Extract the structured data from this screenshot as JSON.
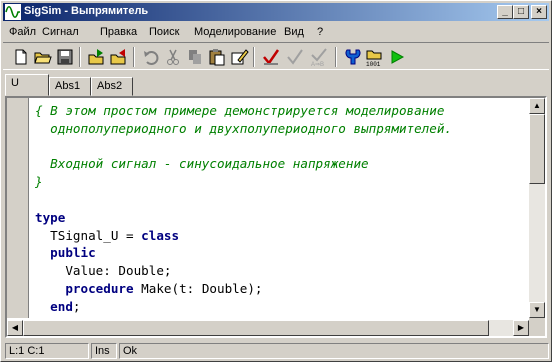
{
  "window": {
    "title": "SigSim - Выпрямитель",
    "minimize": "_",
    "maximize": "□",
    "close": "×"
  },
  "menu": [
    {
      "label": "Файл"
    },
    {
      "label": "Сигнал"
    },
    {
      "label": "Правка"
    },
    {
      "label": "Поиск"
    },
    {
      "label": "Моделирование"
    },
    {
      "label": "Вид"
    },
    {
      "label": "?"
    }
  ],
  "toolbar": {
    "icons": [
      "new-file-icon",
      "open-folder-icon",
      "save-icon",
      "import-signal-icon",
      "export-signal-icon",
      "undo-icon",
      "cut-icon",
      "copy-icon",
      "paste-icon",
      "edit-icon",
      "check-icon",
      "check-disabled-icon",
      "check-ab-icon",
      "settings-icon",
      "compile-icon",
      "run-icon"
    ]
  },
  "tabs": [
    {
      "label": "U",
      "active": true
    },
    {
      "label": "Abs1",
      "active": false
    },
    {
      "label": "Abs2",
      "active": false
    }
  ],
  "code_lines": [
    [
      {
        "t": "{ В этом простом примере демонстрируется моделирование",
        "c": "cm"
      }
    ],
    [
      {
        "t": "  однополупериодного и двухполупериодного выпрямителей.",
        "c": "cm"
      }
    ],
    [
      {
        "t": "",
        "c": "tx"
      }
    ],
    [
      {
        "t": "  Входной сигнал - синусоидальное напряжение",
        "c": "cm"
      }
    ],
    [
      {
        "t": "}",
        "c": "cm"
      }
    ],
    [
      {
        "t": "",
        "c": "tx"
      }
    ],
    [
      {
        "t": "type",
        "c": "kw"
      }
    ],
    [
      {
        "t": "  TSignal_U = ",
        "c": "tx"
      },
      {
        "t": "class",
        "c": "kw"
      }
    ],
    [
      {
        "t": "  public",
        "c": "kw"
      }
    ],
    [
      {
        "t": "    Value: Double;",
        "c": "tx"
      }
    ],
    [
      {
        "t": "    ",
        "c": "tx"
      },
      {
        "t": "procedure",
        "c": "kw"
      },
      {
        "t": " Make(t: Double);",
        "c": "tx"
      }
    ],
    [
      {
        "t": "  end",
        "c": "kw"
      },
      {
        "t": ";",
        "c": "tx"
      }
    ]
  ],
  "status": {
    "position": "L:1  C:1",
    "mode": "Ins",
    "message": "Ok"
  },
  "colors": {
    "titlebar_start": "#0a246a",
    "titlebar_end": "#a6caf0",
    "comment": "#008000",
    "keyword": "#000080"
  }
}
